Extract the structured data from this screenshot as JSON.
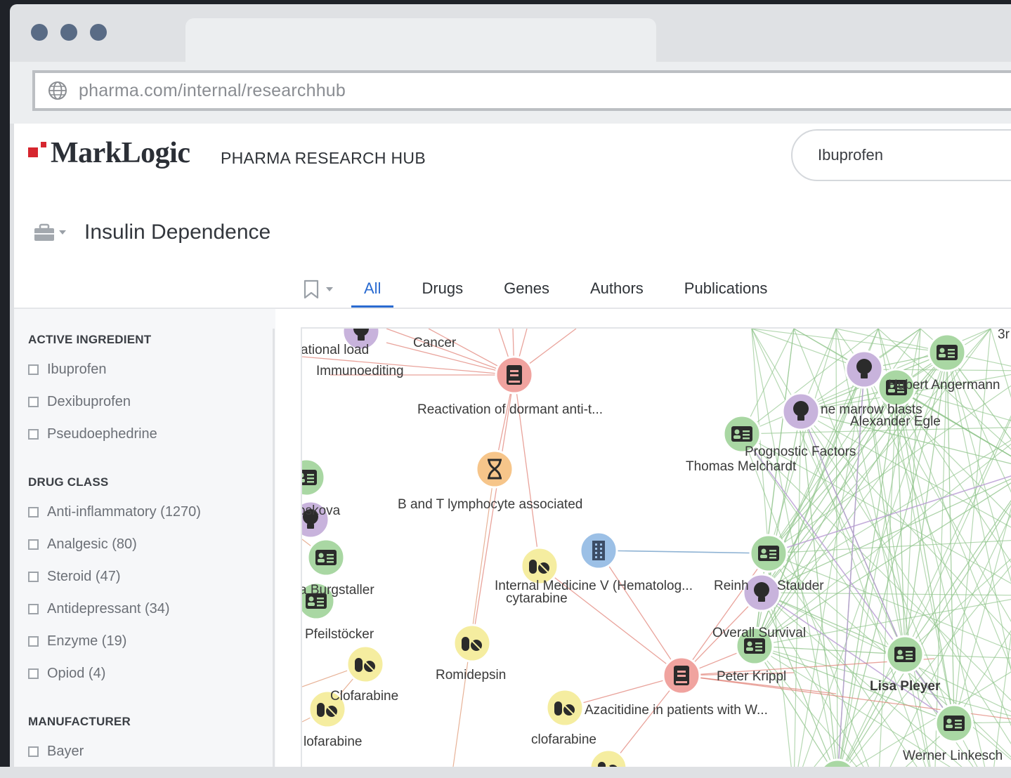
{
  "browser": {
    "url": "pharma.com/internal/researchhub",
    "window_dot_color": "#596b85"
  },
  "header": {
    "logo_text": "MarkLogic",
    "app_name": "PHARMA RESEARCH HUB",
    "search_value": "Ibuprofen",
    "brand_color": "#d6262f"
  },
  "collection": {
    "title": "Insulin Dependence",
    "icon": "briefcase-icon"
  },
  "tabs": [
    {
      "label": "All",
      "active": true
    },
    {
      "label": "Drugs",
      "active": false
    },
    {
      "label": "Genes",
      "active": false
    },
    {
      "label": "Authors",
      "active": false
    },
    {
      "label": "Publications",
      "active": false
    }
  ],
  "sidebar": {
    "facets": [
      {
        "title": "ACTIVE INGREDIENT",
        "items": [
          "Ibuprofen",
          "Dexibuprofen",
          "Pseudoephedrine"
        ]
      },
      {
        "title": "DRUG CLASS",
        "items": [
          "Anti-inflammatory (1270)",
          "Analgesic (80)",
          "Steroid (47)",
          "Antidepressant (34)",
          "Enzyme (19)",
          "Opiod (4)"
        ]
      },
      {
        "title": "MANUFACTURER",
        "items": [
          "Bayer"
        ]
      }
    ]
  },
  "graph": {
    "labels": {
      "l01": "ational load",
      "l02": "Cancer",
      "l03": "Immunoediting",
      "l04": "Reactivation of dormant anti-t...",
      "l05": "B and T lymphocyte associated",
      "l06": "oskova",
      "l07": "a Burgstaller",
      "l08": "Pfeilstöcker",
      "l09": "Clofarabine",
      "l10": "lofarabine",
      "l11": "Romidepsin",
      "l12": "Internal Medicine V (Hematolog...",
      "l13": "cytarabine",
      "l14": "Azacitidine in patients with W...",
      "l15": "clofarabine",
      "l16": "Peter Krippl",
      "l17": "Overall Survival",
      "l18": "Reinh",
      "l19": "Stauder",
      "l20": "Thomas Melchardt",
      "l21": "Prognostic Factors",
      "l22": "ne marrow blasts",
      "l23": "Alexander Egle",
      "l24": "Hubert Angermann",
      "l25": "3r",
      "l26": "Lisa Pleyer",
      "l27": "Werner Linkesch"
    },
    "colors": {
      "publication": "#f0a39f",
      "gene": "#f6c58a",
      "drug": "#f5eda0",
      "author": "#a9d7a3",
      "concept": "#c8b3dc",
      "institution": "#9cc0e6",
      "author_edges": "#8fc48a",
      "publication_edges": "#e07d72"
    }
  }
}
